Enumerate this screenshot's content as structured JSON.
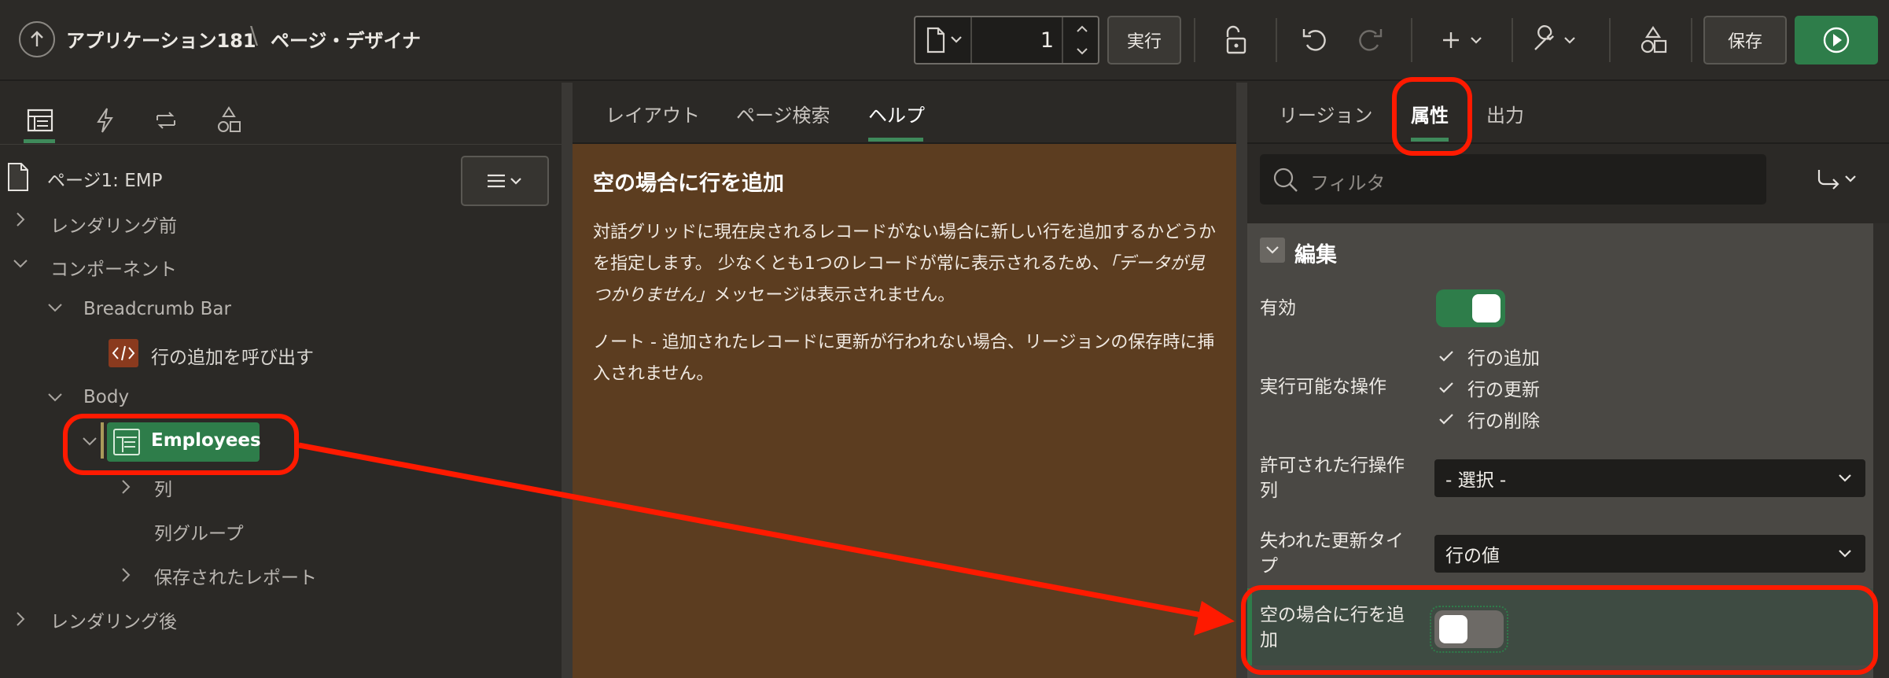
{
  "topbar": {
    "app_title": "アプリケーション181",
    "separator": "\\",
    "page_designer": "ページ・デザイナ",
    "page_number": "1",
    "run_label": "実行",
    "save_label": "保存",
    "icons": [
      "up-arrow-icon",
      "page-icon",
      "lock-icon",
      "undo-icon",
      "redo-icon",
      "plus-icon",
      "wrench-icon",
      "shapes-icon",
      "run-icon"
    ]
  },
  "left": {
    "tabs": [
      "rendering-tab",
      "dynamic-actions-tab",
      "processing-tab",
      "shared-components-tab"
    ],
    "tree": {
      "page": "ページ1: EMP",
      "before_render": "レンダリング前",
      "components": "コンポーネント",
      "breadcrumb_bar": "Breadcrumb Bar",
      "call_add_row": "行の追加を呼び出す",
      "body": "Body",
      "employees": "Employees",
      "columns": "列",
      "column_groups": "列グループ",
      "saved_reports": "保存されたレポート",
      "after_render": "レンダリング後"
    }
  },
  "middle": {
    "tabs": {
      "layout": "レイアウト",
      "page_search": "ページ検索",
      "help": "ヘルプ"
    },
    "help": {
      "title": "空の場合に行を追加",
      "p1_a": "対話グリッドに現在戻されるレコードがない場合に新しい行を追加するかどうかを指定します。 少なくとも1つのレコードが常に表示されるため、",
      "p1_em": "「データが見つかりません」",
      "p1_b": "メッセージは表示されません。",
      "p2": "ノート - 追加されたレコードに更新が行われない場合、リージョンの保存時に挿入されません。"
    }
  },
  "right": {
    "tabs": {
      "region": "リージョン",
      "attributes": "属性",
      "output": "出力"
    },
    "filter_placeholder": "フィルタ",
    "group_title": "編集",
    "enabled_label": "有効",
    "allowed_ops_label": "実行可能な操作",
    "ops": {
      "add": "行の追加",
      "update": "行の更新",
      "delete": "行の削除"
    },
    "row_op_col_label": "許可された行操作列",
    "row_op_col_value": "- 選択 -",
    "lost_update_label": "失われた更新タイプ",
    "lost_update_value": "行の値",
    "add_row_if_empty_label": "空の場合に行を追加",
    "enabled": true,
    "add_row_if_empty": false
  },
  "colors": {
    "accent_green": "#2e7d4a",
    "help_bg": "#5c3d20",
    "annotation_red": "#ff1a00"
  }
}
